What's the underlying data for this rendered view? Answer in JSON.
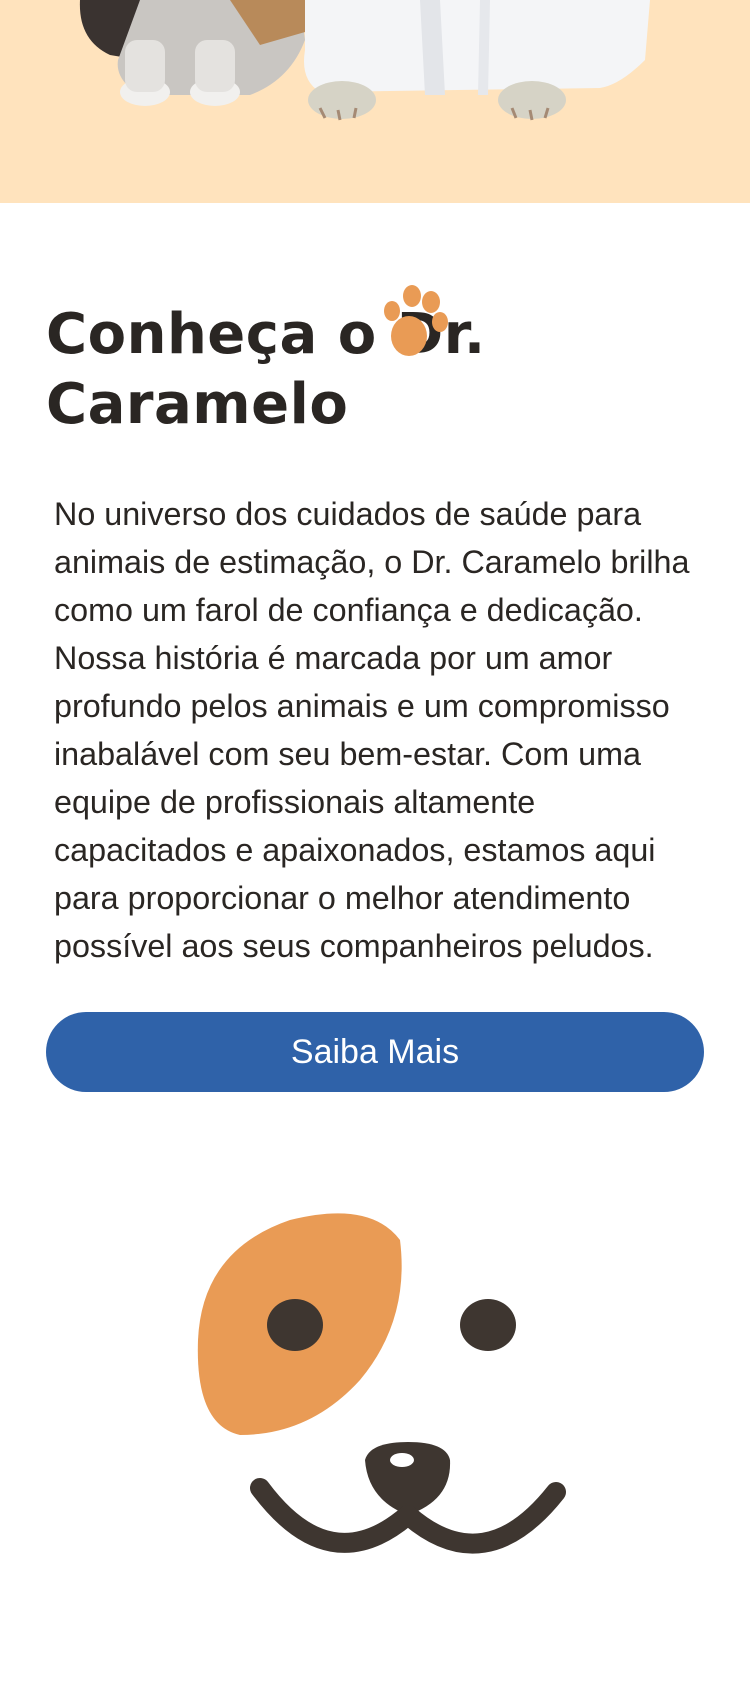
{
  "hero": {
    "image": "cat-and-vet-photo",
    "background": "#ffe3bd"
  },
  "about": {
    "title": "Conheça o Dr. Caramelo",
    "paw_icon": "paw-print-icon",
    "description": "No universo dos cuidados de saúde para animais de estimação, o Dr. Caramelo brilha como um farol de confiança e dedicação. Nossa história é marcada por um amor profundo pelos animais e um compromisso inabalável com seu bem-estar. Com uma equipe de profissionais altamente capacitados e apaixonados, estamos aqui para proporcionar o melhor atendimento possível aos seus companheiros peludos.",
    "cta_label": "Saiba Mais"
  },
  "illustration": {
    "icon": "dog-face-icon"
  },
  "colors": {
    "accent": "#2f62a9",
    "orange": "#e99b55",
    "dark": "#3e3630",
    "text": "#2a2623"
  }
}
